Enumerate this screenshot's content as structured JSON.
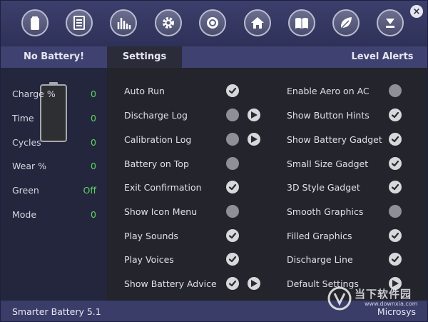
{
  "toolbar": {
    "buttons": [
      {
        "name": "battery-icon"
      },
      {
        "name": "list-icon"
      },
      {
        "name": "chart-icon"
      },
      {
        "name": "gear-icon"
      },
      {
        "name": "target-icon"
      },
      {
        "name": "home-icon"
      },
      {
        "name": "book-icon"
      },
      {
        "name": "leaf-icon"
      },
      {
        "name": "minimize-icon"
      }
    ],
    "close_label": "×"
  },
  "tabs": {
    "no_battery": "No Battery!",
    "settings": "Settings",
    "level_alerts": "Level Alerts"
  },
  "stats": [
    {
      "label": "Charge %",
      "value": "0"
    },
    {
      "label": "Time",
      "value": "0"
    },
    {
      "label": "Cycles",
      "value": "0"
    },
    {
      "label": "Wear %",
      "value": "0"
    },
    {
      "label": "Green",
      "value": "Off"
    },
    {
      "label": "Mode",
      "value": "0"
    }
  ],
  "settings_left": [
    {
      "label": "Auto Run",
      "checked": true,
      "play": false
    },
    {
      "label": "Discharge Log",
      "checked": false,
      "play": true
    },
    {
      "label": "Calibration Log",
      "checked": false,
      "play": true
    },
    {
      "label": "Battery on Top",
      "checked": false,
      "play": false
    },
    {
      "label": "Exit Confirmation",
      "checked": true,
      "play": false
    },
    {
      "label": "Show Icon Menu",
      "checked": false,
      "play": false
    },
    {
      "label": "Play Sounds",
      "checked": true,
      "play": false
    },
    {
      "label": "Play Voices",
      "checked": true,
      "play": false
    },
    {
      "label": "Show Battery Advice",
      "checked": true,
      "play": true
    }
  ],
  "settings_right": [
    {
      "label": "Enable Aero on AC",
      "checked": false,
      "play": false
    },
    {
      "label": "Show Button Hints",
      "checked": true,
      "play": false
    },
    {
      "label": "Show Battery Gadget",
      "checked": true,
      "play": false
    },
    {
      "label": "Small Size Gadget",
      "checked": true,
      "play": false
    },
    {
      "label": "3D Style Gadget",
      "checked": true,
      "play": false
    },
    {
      "label": "Smooth Graphics",
      "checked": false,
      "play": false
    },
    {
      "label": "Filled Graphics",
      "checked": true,
      "play": false
    },
    {
      "label": "Discharge Line",
      "checked": true,
      "play": false
    },
    {
      "label": "Default Settings",
      "checked": null,
      "play": true
    }
  ],
  "status": {
    "app_name": "Smarter Battery 5.1",
    "vendor": "Microsys"
  },
  "watermark": {
    "text_cn": "当下软件园",
    "url": "www.downxia.com"
  },
  "colors": {
    "accent_green": "#5fd45f",
    "toolbar_bg": "#3a3d68",
    "panel_bg": "#23242c"
  }
}
